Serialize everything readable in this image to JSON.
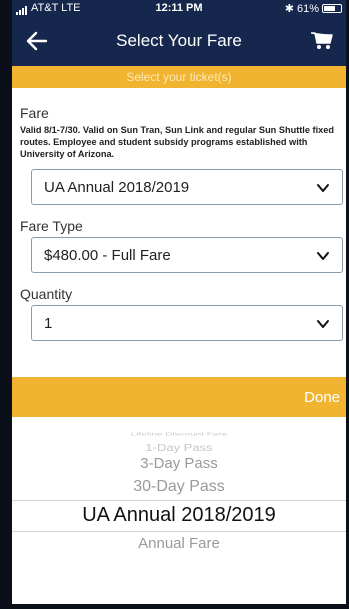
{
  "status": {
    "carrier": "AT&T  LTE",
    "time": "12:11 PM",
    "battery": "61%"
  },
  "nav": {
    "title": "Select Your Fare",
    "back_icon": "back-arrow-icon",
    "cart_icon": "cart-icon"
  },
  "banner": "Select your ticket(s)",
  "fare": {
    "label": "Fare",
    "description": "Valid 8/1-7/30. Valid on Sun Tran, Sun Link and regular Sun  Shuttle fixed routes. Employee and student subsidy programs  established with University of Arizona.",
    "value": "UA Annual 2018/2019"
  },
  "fare_type": {
    "label": "Fare Type",
    "value": "$480.00 - Full Fare"
  },
  "quantity": {
    "label": "Quantity",
    "value": "1"
  },
  "picker": {
    "done_label": "Done",
    "options": [
      "Lifeline Discount Fare",
      "1-Day Pass",
      "3-Day Pass",
      "30-Day Pass",
      "UA Annual 2018/2019",
      "Annual Fare"
    ],
    "selected": "UA Annual 2018/2019"
  },
  "colors": {
    "navy": "#16274d",
    "gold": "#f1b431"
  }
}
